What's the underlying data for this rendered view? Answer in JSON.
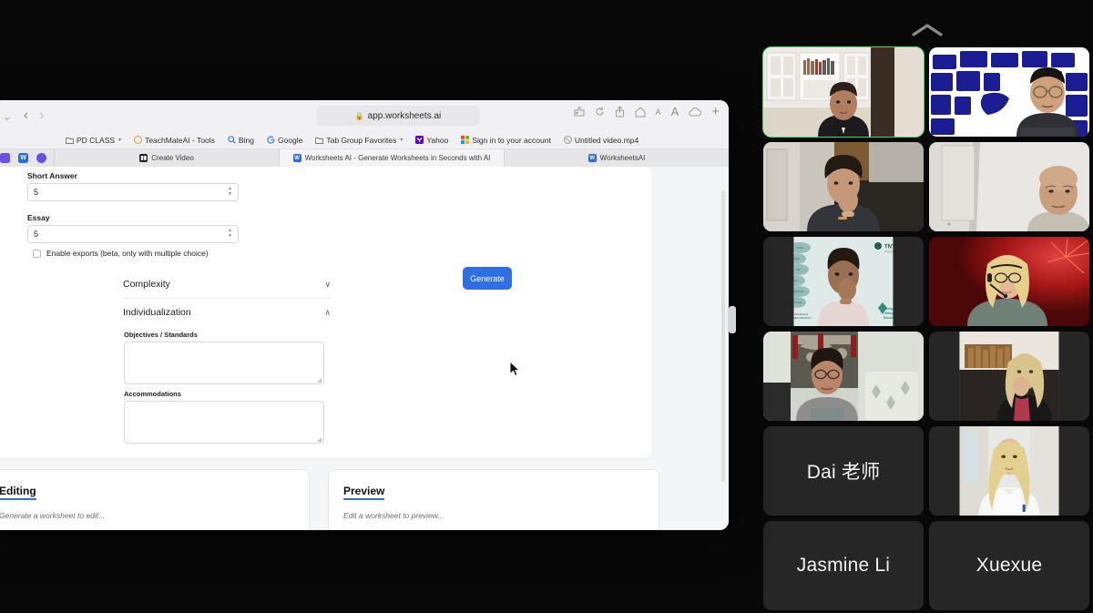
{
  "meeting": {
    "collapse_icon": "chevron-up-icon",
    "participants": [
      {
        "name": "",
        "has_video": true,
        "speaking": true,
        "scene": "man-white-bookshelf"
      },
      {
        "name": "",
        "has_video": true,
        "speaking": false,
        "scene": "man-blue-globe-bg"
      },
      {
        "name": "",
        "has_video": true,
        "speaking": false,
        "scene": "woman-hallway"
      },
      {
        "name": "",
        "has_video": true,
        "speaking": false,
        "scene": "bald-man-white-wall"
      },
      {
        "name": "",
        "has_video": true,
        "speaking": false,
        "scene": "woman-tntp-slide-bg"
      },
      {
        "name": "",
        "has_video": true,
        "speaking": false,
        "scene": "woman-headset-red-bg"
      },
      {
        "name": "",
        "has_video": true,
        "speaking": false,
        "scene": "woman-glasses-patio"
      },
      {
        "name": "",
        "has_video": true,
        "speaking": false,
        "scene": "woman-blonde-livingroom"
      },
      {
        "name": "Dai 老师",
        "has_video": false,
        "speaking": false,
        "scene": ""
      },
      {
        "name": "",
        "has_video": true,
        "speaking": false,
        "scene": "woman-blonde-white-shirt"
      },
      {
        "name": "Jasmine Li",
        "has_video": false,
        "speaking": false,
        "scene": ""
      },
      {
        "name": "Xuexue",
        "has_video": false,
        "speaking": false,
        "scene": ""
      }
    ]
  },
  "browser": {
    "toolbar": {
      "sidebar_toggle": "sidebar-chevron-icon",
      "back_label": "‹",
      "forward_label": "›",
      "address": "app.worksheets.ai",
      "lock_icon": "lock-icon",
      "right_icons": [
        {
          "name": "extensions-icon",
          "glyph": "⚙"
        },
        {
          "name": "reload-icon",
          "glyph": "⟳"
        },
        {
          "name": "share-icon",
          "glyph": "↑"
        },
        {
          "name": "home-icon",
          "glyph": "⌂"
        },
        {
          "name": "text-size-decrease-icon",
          "glyph": "A"
        },
        {
          "name": "text-size-increase-icon",
          "glyph": "A"
        },
        {
          "name": "icloud-icon",
          "glyph": "☁"
        },
        {
          "name": "new-tab-icon",
          "glyph": "+"
        }
      ]
    },
    "bookmarks": [
      {
        "label": "PD CLASS",
        "icon": "folder-icon",
        "caret": true
      },
      {
        "label": "TeachMateAI - Tools",
        "icon": "teachmate-icon",
        "caret": false
      },
      {
        "label": "Bing",
        "icon": "search-icon",
        "caret": false
      },
      {
        "label": "Google",
        "icon": "google-icon",
        "caret": false
      },
      {
        "label": "Tab Group Favorites",
        "icon": "folder-icon",
        "caret": true
      },
      {
        "label": "Yahoo",
        "icon": "yahoo-icon",
        "caret": false
      },
      {
        "label": "Sign in to your account",
        "icon": "microsoft-icon",
        "caret": false
      },
      {
        "label": "Untitled video.mp4",
        "icon": "video-file-icon",
        "caret": false
      }
    ],
    "pinned_tabs": [
      {
        "name": "pinned-tab-1",
        "letter": "",
        "color": "#6b4ee6"
      },
      {
        "name": "pinned-tab-worksheets",
        "letter": "W",
        "color": "#2a6ae0"
      },
      {
        "name": "pinned-tab-3",
        "letter": "",
        "color": "#6b4ee6"
      }
    ],
    "tabs": [
      {
        "label": "Create Video",
        "favicon": "create-video-icon",
        "selected": false
      },
      {
        "label": "Worksheets AI - Generate Worksheets in Seconds with AI",
        "favicon": "worksheets-icon",
        "selected": true
      },
      {
        "label": "WorksheetsAI",
        "favicon": "worksheets-icon",
        "selected": false
      }
    ]
  },
  "page": {
    "short_answer": {
      "label": "Short Answer",
      "value": "5"
    },
    "essay": {
      "label": "Essay",
      "value": "5"
    },
    "enable_exports": {
      "label": "Enable exports (beta, only with multiple choice)",
      "checked": false
    },
    "accordions": [
      {
        "label": "Complexity",
        "expanded": false,
        "caret": "∨"
      },
      {
        "label": "Individualization",
        "expanded": true,
        "caret": "∧"
      }
    ],
    "objectives": {
      "label": "Objectives / Standards",
      "value": ""
    },
    "accommodations": {
      "label": "Accommodations",
      "value": ""
    },
    "generate_button": "Generate",
    "editing_panel": {
      "title": "Editing",
      "placeholder": "Generate a worksheet to edit..."
    },
    "preview_panel": {
      "title": "Preview",
      "placeholder": "Edit a worksheet to preview..."
    }
  },
  "colors": {
    "accent": "#2f6fe4",
    "speaking_outline": "#3ddc55",
    "page_bg": "#f4f5f7",
    "tile_bg": "#262626"
  }
}
